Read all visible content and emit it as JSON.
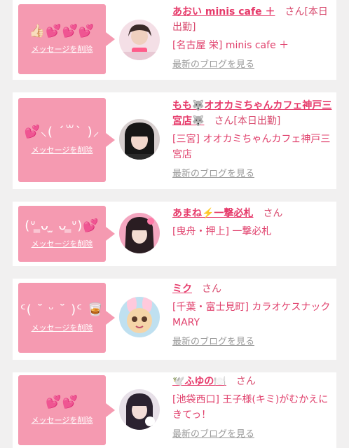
{
  "colors": {
    "accent": "#e63a6a",
    "bubble": "#f59ab1",
    "link_gray": "#9a9a9a"
  },
  "cards": [
    {
      "message": "👍🏻💕💕💕",
      "delete_label": "メッセージを削除",
      "name": "あおい minis cafe ＋",
      "san": "さん[本日出勤]",
      "shop": "[名古屋 栄] minis cafe ＋",
      "blog": "最新のブログを見る"
    },
    {
      "message": "💕⸜(  ´꒳` )⸝",
      "delete_label": "メッセージを削除",
      "name": "もも🐺オオカミちゃんカフェ神戸三宮店🐺",
      "san": "さん[本日出勤]",
      "shop": "[三宮] オオカミちゃんカフェ神戸三宮店",
      "blog": "最新のブログを見る"
    },
    {
      "message": "(ᐡ ̳ᴗ ̫ ᴗ ̳ᐡ)💕",
      "delete_label": "メッセージを削除",
      "name": "あまね⚡️一撃必札",
      "san": "さん",
      "shop": "[曳舟・押上] 一撃必札",
      "blog": "最新のブログを見る"
    },
    {
      "message": "ᑦ( ˘ ᵕ ˘ )ᑦ 🥃",
      "delete_label": "メッセージを削除",
      "name": "ミク",
      "san": "さん",
      "shop": "[千葉・富士見町] カラオケスナック MARY",
      "blog": "最新のブログを見る"
    },
    {
      "message": "💕💕",
      "delete_label": "メッセージを削除",
      "name": "🕊️ふゆの🍽️",
      "san": "さん",
      "shop": "[池袋西口] 王子様(キミ)がむかえにきてっ！",
      "blog": "最新のブログを見る"
    }
  ]
}
